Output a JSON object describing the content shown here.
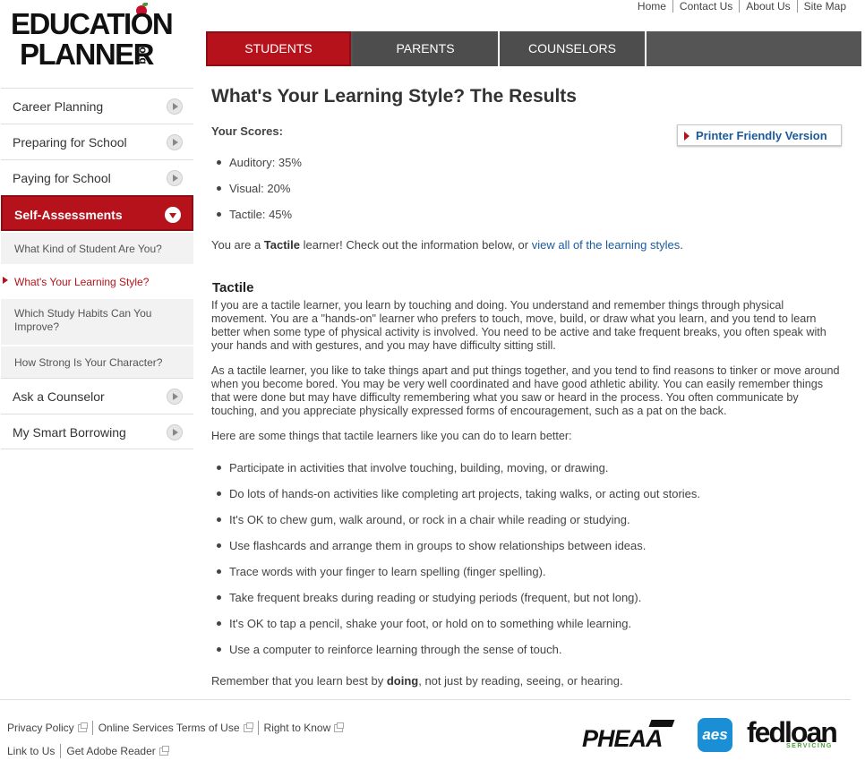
{
  "logo": {
    "line1": "EDUCATION",
    "line2": "PLANNER",
    "suffix": ".org"
  },
  "utility_nav": [
    "Home",
    "Contact Us",
    "About Us",
    "Site Map"
  ],
  "main_nav": {
    "tabs": [
      "STUDENTS",
      "PARENTS",
      "COUNSELORS"
    ],
    "active": "STUDENTS"
  },
  "sidebar": {
    "items": [
      {
        "label": "Career Planning"
      },
      {
        "label": "Preparing for School"
      },
      {
        "label": "Paying for School"
      },
      {
        "label": "Self-Assessments"
      }
    ],
    "sub_items": [
      {
        "label": "What Kind of Student Are You?"
      },
      {
        "label": "What's Your Learning Style?"
      },
      {
        "label": "Which Study Habits Can You Improve?"
      },
      {
        "label": "How Strong Is Your Character?"
      }
    ],
    "items_after": [
      {
        "label": "Ask a Counselor"
      },
      {
        "label": "My Smart Borrowing"
      }
    ]
  },
  "page": {
    "title": "What's Your Learning Style? The Results",
    "printer_friendly": "Printer Friendly Version",
    "scores_heading": "Your Scores:",
    "scores": [
      "Auditory: 35%",
      "Visual: 20%",
      "Tactile: 45%"
    ],
    "result_prefix": "You are a ",
    "result_style": "Tactile",
    "result_middle": " learner! Check out the information below, or ",
    "result_link": "view all of the learning styles",
    "result_end": ".",
    "section_heading": "Tactile",
    "paragraph1": "If you are a tactile learner, you learn by touching and doing. You understand and remember things through physical movement. You are a \"hands-on\" learner who prefers to touch, move, build, or draw what you learn, and you tend to learn better when some type of physical activity is involved. You need to be active and take frequent breaks, you often speak with your hands and with gestures, and you may have difficulty sitting still.",
    "paragraph2": "As a tactile learner, you like to take things apart and put things together, and you tend to find reasons to tinker or move around when you become bored. You may be very well coordinated and have good athletic ability. You can easily remember things that were done but may have difficulty remembering what you saw or heard in the process. You often communicate by touching, and you appreciate physically expressed forms of encouragement, such as a pat on the back.",
    "paragraph3": "Here are some things that tactile learners like you can do to learn better:",
    "tips": [
      "Participate in activities that involve touching, building, moving, or drawing.",
      "Do lots of hands-on activities like completing art projects, taking walks, or acting out stories.",
      "It's OK to chew gum, walk around, or rock in a chair while reading or studying.",
      "Use flashcards and arrange them in groups to show relationships between ideas.",
      "Trace words with your finger to learn spelling (finger spelling).",
      "Take frequent breaks during reading or studying periods (frequent, but not long).",
      "It's OK to tap a pencil, shake your foot, or hold on to something while learning.",
      "Use a computer to reinforce learning through the sense of touch."
    ],
    "closing_prefix": "Remember that you learn best by ",
    "closing_bold": "doing",
    "closing_end": ", not just by reading, seeing, or hearing."
  },
  "footer": {
    "row1": [
      "Privacy Policy",
      "Online Services Terms of Use",
      "Right to Know"
    ],
    "row2": [
      "Link to Us",
      "Get Adobe Reader"
    ],
    "partners": {
      "pheaa": "PHEAA",
      "aes": "aes",
      "fedloan": "fedloan",
      "fedloan_sub": "SERVICING"
    }
  },
  "colors": {
    "brand_red": "#b5121b",
    "nav_gray": "#4d4d4d",
    "link_blue": "#1a5a9c"
  }
}
